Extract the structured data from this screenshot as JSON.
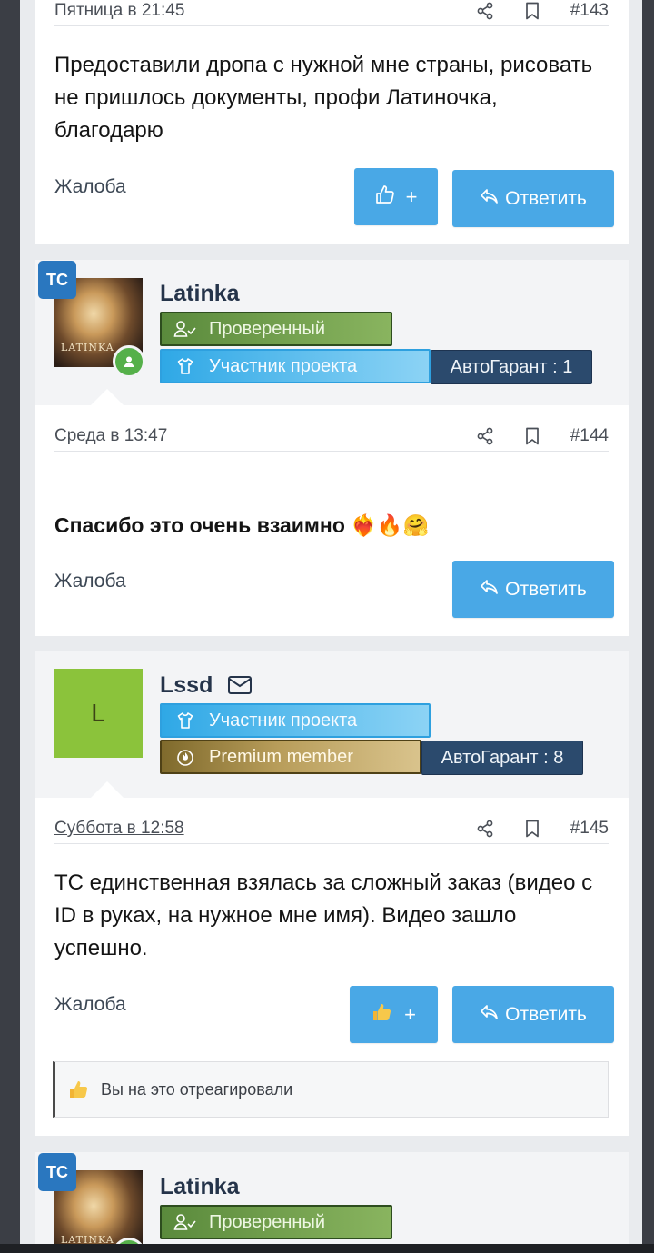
{
  "colors": {
    "accent": "#49a8e6",
    "username": "#25344a",
    "tc_badge": "#2a77bf",
    "online": "#55b04a"
  },
  "post_143": {
    "date": "Пятница в 21:45",
    "number": "#143",
    "text": "Предоставили дропа с нужной мне страны, рисовать не пришлось документы, профи Латиночка, благодарю",
    "report": "Жалоба",
    "like_plus": "+",
    "reply": "Ответить"
  },
  "user_1": {
    "tc": "ТС",
    "name": "Latinka",
    "avatar_text": "LATINKA",
    "badges": {
      "verified": "Проверенный",
      "member": "Участник проекта",
      "garant": "АвтоГарант : 1"
    }
  },
  "post_144": {
    "date": "Среда в 13:47",
    "number": "#144",
    "text": "Спасибо это очень взаимно",
    "emojis": "❤️‍🔥🔥🤗",
    "report": "Жалоба",
    "reply": "Ответить"
  },
  "user_2": {
    "initial": "L",
    "name": "Lssd",
    "badges": {
      "member": "Участник проекта",
      "premium": "Premium member",
      "garant": "АвтоГарант : 8"
    }
  },
  "post_145": {
    "date": "Суббота в 12:58",
    "number": "#145",
    "text": "ТС единственная взялась за сложный заказ (видео с ID в руках, на нужное мне имя). Видео зашло успешно.",
    "report": "Жалоба",
    "like_plus": "+",
    "reply": "Ответить",
    "reacted": "Вы на это отреагировали"
  },
  "user_3": {
    "tc": "ТС",
    "name": "Latinka",
    "avatar_text": "LATINKA",
    "badges": {
      "verified": "Проверенный"
    }
  }
}
